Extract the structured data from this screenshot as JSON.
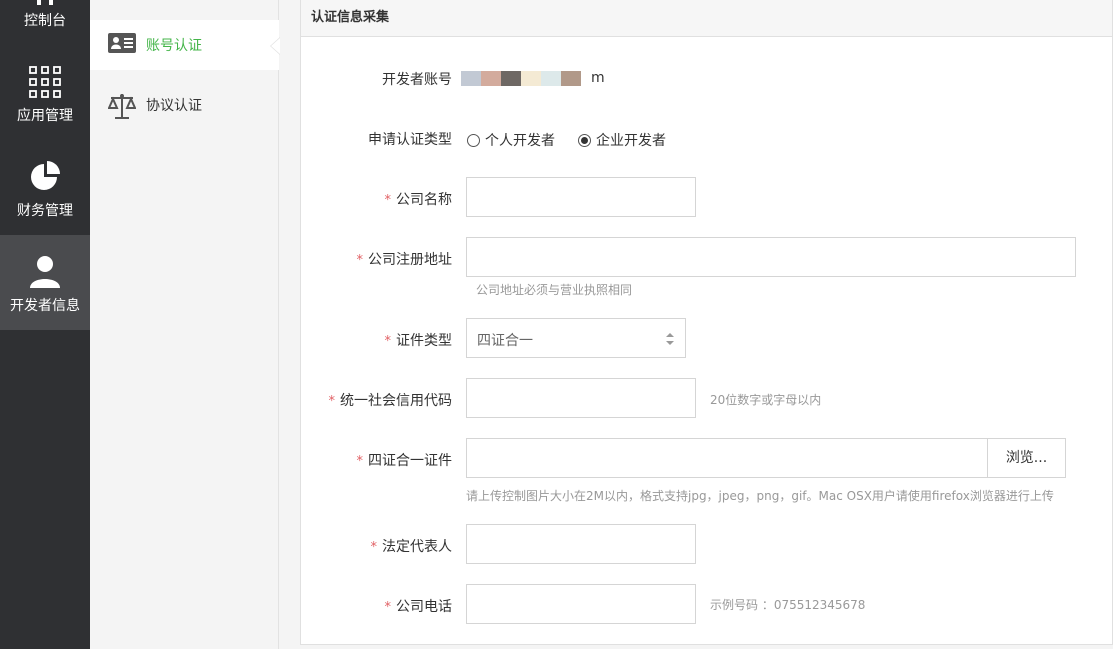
{
  "nav": {
    "items": [
      {
        "label": "控制台",
        "icon": "dashboard-icon"
      },
      {
        "label": "应用管理",
        "icon": "app-grid-icon"
      },
      {
        "label": "财务管理",
        "icon": "pie-chart-icon"
      },
      {
        "label": "开发者信息",
        "icon": "user-icon",
        "active": true
      }
    ]
  },
  "subnav": {
    "items": [
      {
        "label": "账号认证",
        "icon": "id-card-icon",
        "active": true
      },
      {
        "label": "协议认证",
        "icon": "scale-icon"
      }
    ]
  },
  "panel": {
    "title": "认证信息采集"
  },
  "form": {
    "account": {
      "label": "开发者账号",
      "value_suffix": "m"
    },
    "type": {
      "label": "申请认证类型",
      "options": [
        "个人开发者",
        "企业开发者"
      ],
      "selected": "企业开发者"
    },
    "company_name": {
      "label": "公司名称",
      "value": ""
    },
    "company_address": {
      "label": "公司注册地址",
      "value": "",
      "hint": "公司地址必须与营业执照相同"
    },
    "cert_type": {
      "label": "证件类型",
      "selected": "四证合一"
    },
    "credit_code": {
      "label": "统一社会信用代码",
      "value": "",
      "hint": "20位数字或字母以内"
    },
    "cert_file": {
      "label": "四证合一证件",
      "browse": "浏览...",
      "hint": "请上传控制图片大小在2M以内，格式支持jpg，jpeg，png，gif。Mac OSX用户请使用firefox浏览器进行上传"
    },
    "legal_rep": {
      "label": "法定代表人",
      "value": ""
    },
    "company_phone": {
      "label": "公司电话",
      "value": "",
      "hint": "示例号码 ：075512345678"
    },
    "required_mark": "*"
  },
  "colors": {
    "nav_bg": "#2f3033",
    "nav_active": "#4a4b4e",
    "accent_green": "#44b549",
    "required_red": "#e15f63",
    "redaction": [
      "#c2c9d4",
      "#d3ab9d",
      "#6e6864",
      "#f4ead4",
      "#dde9ea",
      "#b19989"
    ]
  }
}
